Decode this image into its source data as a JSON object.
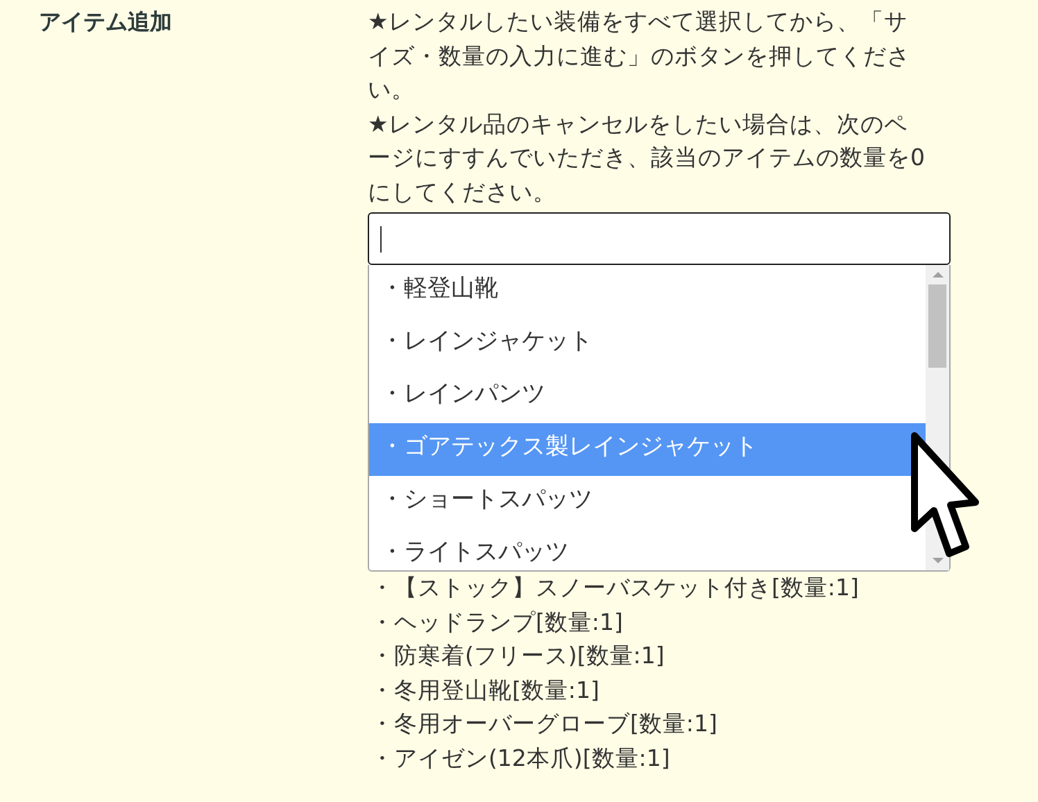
{
  "label": "アイテム追加",
  "notes": [
    "★レンタルしたい装備をすべて選択してから、「サイズ・数量の入力に進む」のボタンを押してください。",
    "★レンタル品のキャンセルをしたい場合は、次のページにすすんでいただき、該当のアイテムの数量を0にしてください。"
  ],
  "options": [
    {
      "label": "・軽登山靴",
      "selected": false
    },
    {
      "label": "・レインジャケット",
      "selected": false
    },
    {
      "label": "・レインパンツ",
      "selected": false
    },
    {
      "label": "・ゴアテックス製レインジャケット",
      "selected": true
    },
    {
      "label": "・ショートスパッツ",
      "selected": false
    },
    {
      "label": "・ライトスパッツ",
      "selected": false
    }
  ],
  "selected_items": [
    "・【ストック】スノーバスケット付き[数量:1]",
    "・ヘッドランプ[数量:1]",
    "・防寒着(フリース)[数量:1]",
    "・冬用登山靴[数量:1]",
    "・冬用オーバーグローブ[数量:1]",
    "・アイゼン(12本爪)[数量:1]"
  ]
}
